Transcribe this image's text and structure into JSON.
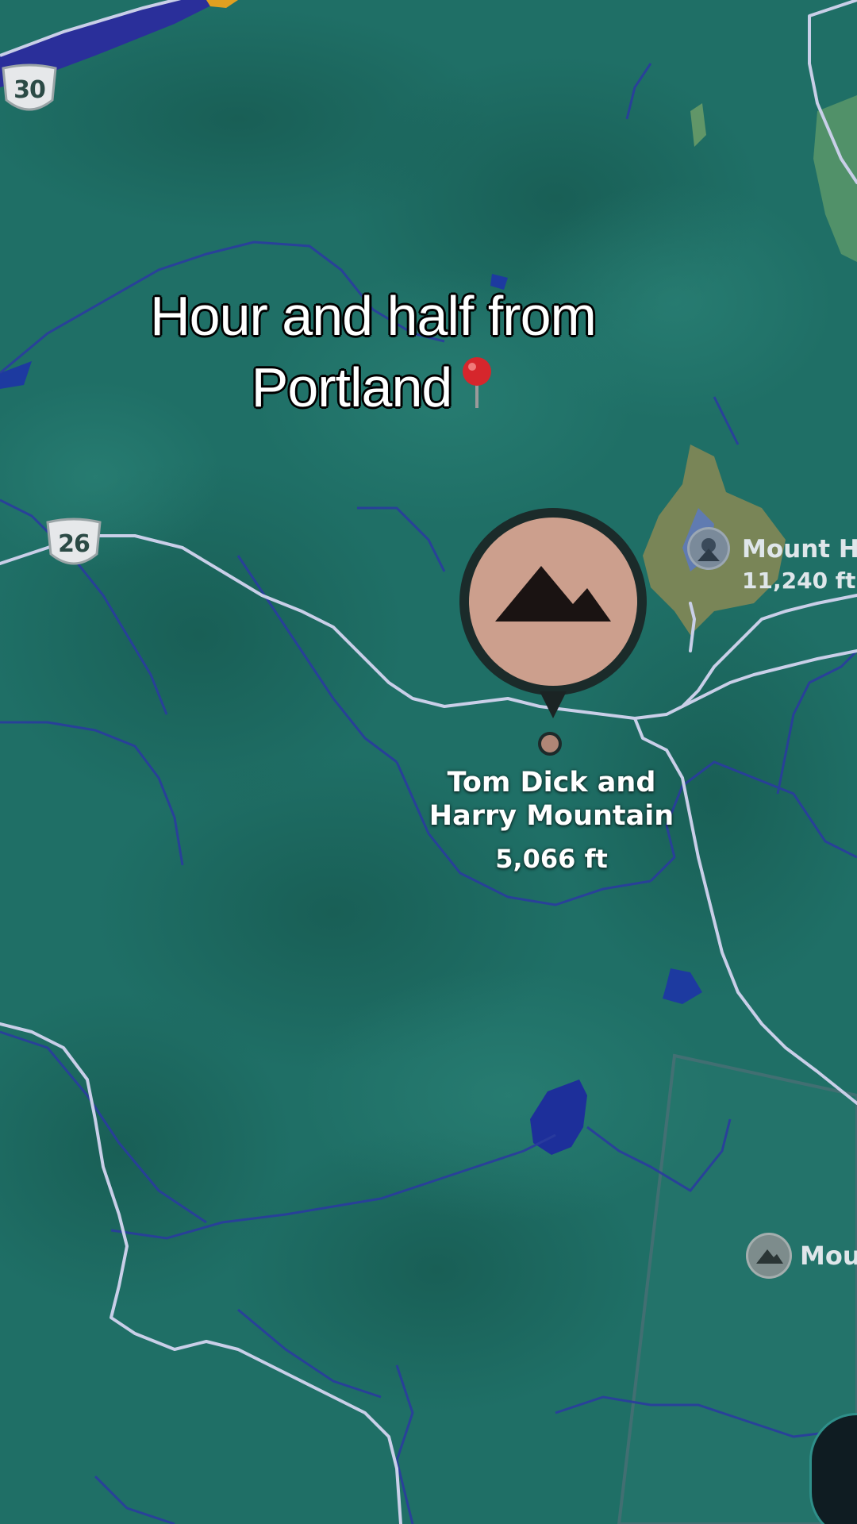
{
  "caption": {
    "line1": "Hour and half from",
    "line2": "Portland",
    "pin": "round-pushpin-icon"
  },
  "highway_shields": [
    {
      "number": "30"
    },
    {
      "number": "26"
    }
  ],
  "selected_place": {
    "name": "Tom Dick and Harry Mountain",
    "name_line1": "Tom Dick and",
    "name_line2": "Harry Mountain",
    "elevation": "5,066 ft",
    "icon": "mountain-icon"
  },
  "places": {
    "mount_hood": {
      "name": "Mount H",
      "elevation": "11,240 ft",
      "icon": "volcano-icon"
    },
    "mou": {
      "name": "Mou",
      "icon": "mountain-icon"
    }
  },
  "colors": {
    "land": "#1f6f66",
    "road": "#c9cfe8",
    "water": "#1d2f9a",
    "marker_fill": "#c99a86",
    "park": "#8a8a55"
  }
}
